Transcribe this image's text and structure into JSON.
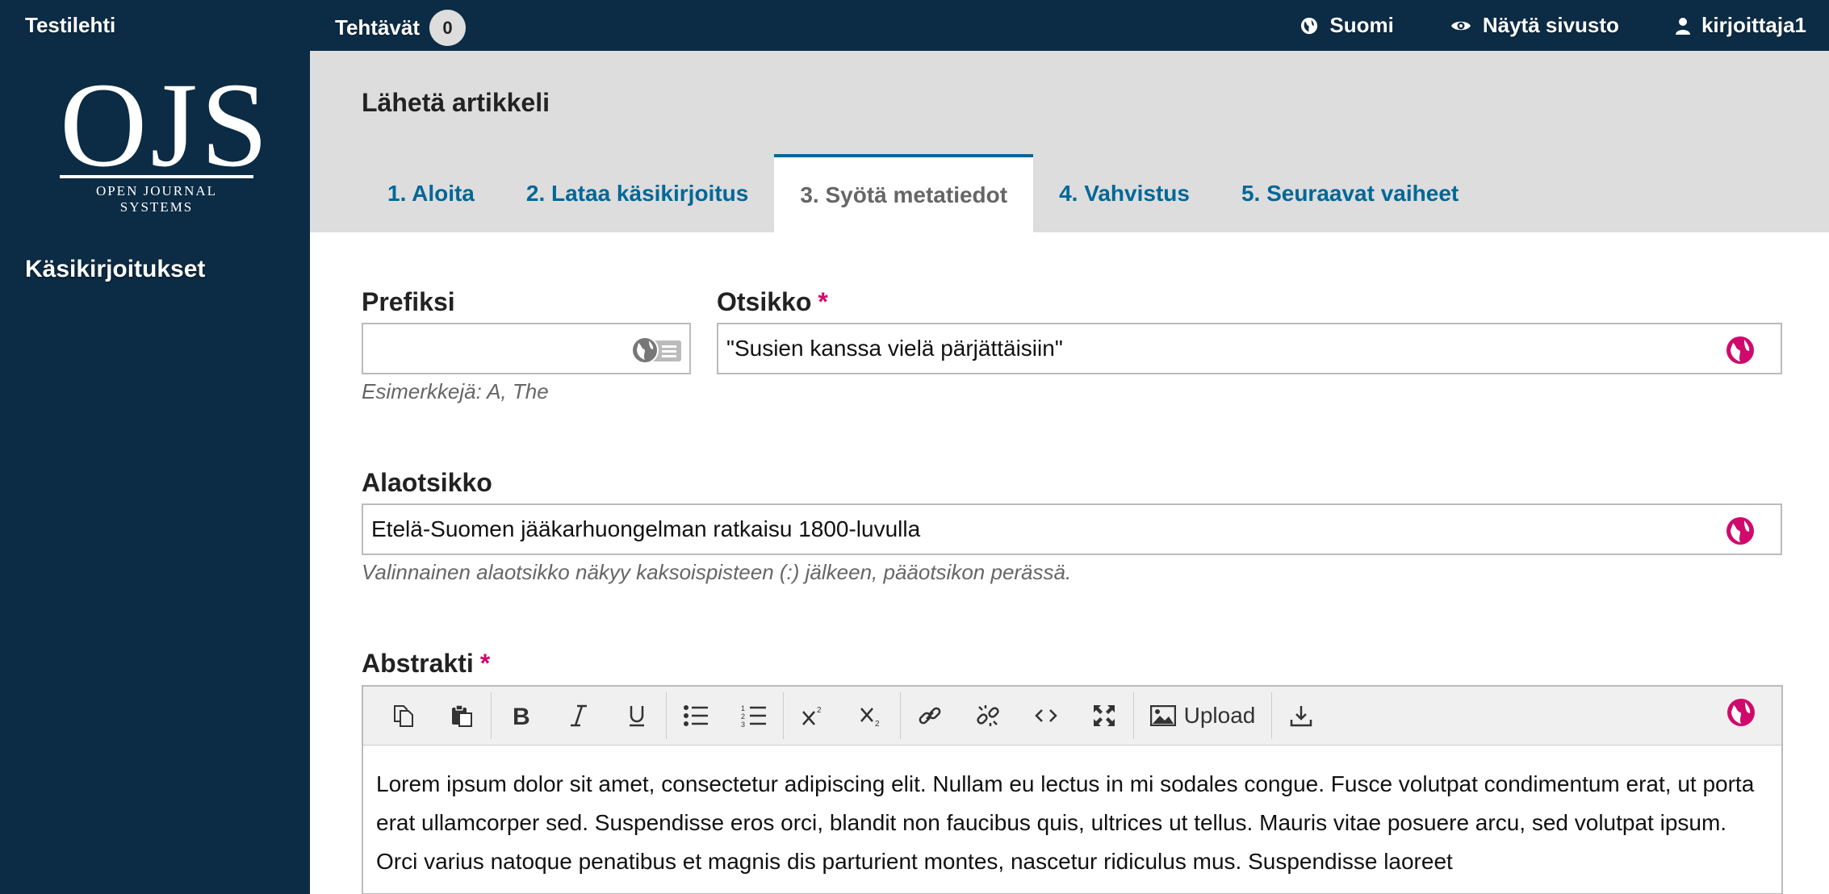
{
  "topbar": {
    "journal": "Testilehti",
    "tasks_label": "Tehtävät",
    "tasks_count": "0",
    "language": "Suomi",
    "view_site": "Näytä sivusto",
    "user": "kirjoittaja1"
  },
  "sidebar": {
    "logo_big": "OJS",
    "logo_small": "OPEN JOURNAL SYSTEMS",
    "nav_item": "Käsikirjoitukset"
  },
  "header": {
    "title": "Lähetä artikkeli",
    "tabs": [
      {
        "label": "1. Aloita"
      },
      {
        "label": "2. Lataa käsikirjoitus"
      },
      {
        "label": "3. Syötä metatiedot"
      },
      {
        "label": "4. Vahvistus"
      },
      {
        "label": "5. Seuraavat vaiheet"
      }
    ],
    "active_tab": "3. Syötä metatiedot"
  },
  "form": {
    "prefix": {
      "label": "Prefiksi",
      "value": "",
      "help": "Esimerkkejä: A, The"
    },
    "title": {
      "label": "Otsikko",
      "required_mark": "*",
      "value": "\"Susien kanssa vielä pärjättäisiin\""
    },
    "subtitle": {
      "label": "Alaotsikko",
      "value": "Etelä-Suomen jääkarhuongelman ratkaisu 1800-luvulla",
      "help": "Valinnainen alaotsikko näkyy kaksoispisteen (:) jälkeen, pääotsikon perässä."
    },
    "abstract": {
      "label": "Abstrakti",
      "required_mark": "*",
      "upload_label": "Upload",
      "text": "Lorem ipsum dolor sit amet, consectetur adipiscing elit. Nullam eu lectus in mi sodales congue. Fusce volutpat condimentum erat, ut porta erat ullamcorper sed. Suspendisse eros orci, blandit non faucibus quis, ultrices ut tellus. Mauris vitae posuere arcu, sed volutpat ipsum. Orci varius natoque penatibus et magnis dis parturient montes, nascetur ridiculus mus. Suspendisse laoreet"
    }
  },
  "colors": {
    "navy": "#0c2b44",
    "link": "#006798",
    "required": "#d00a6c",
    "header_bg": "#dddddd"
  }
}
